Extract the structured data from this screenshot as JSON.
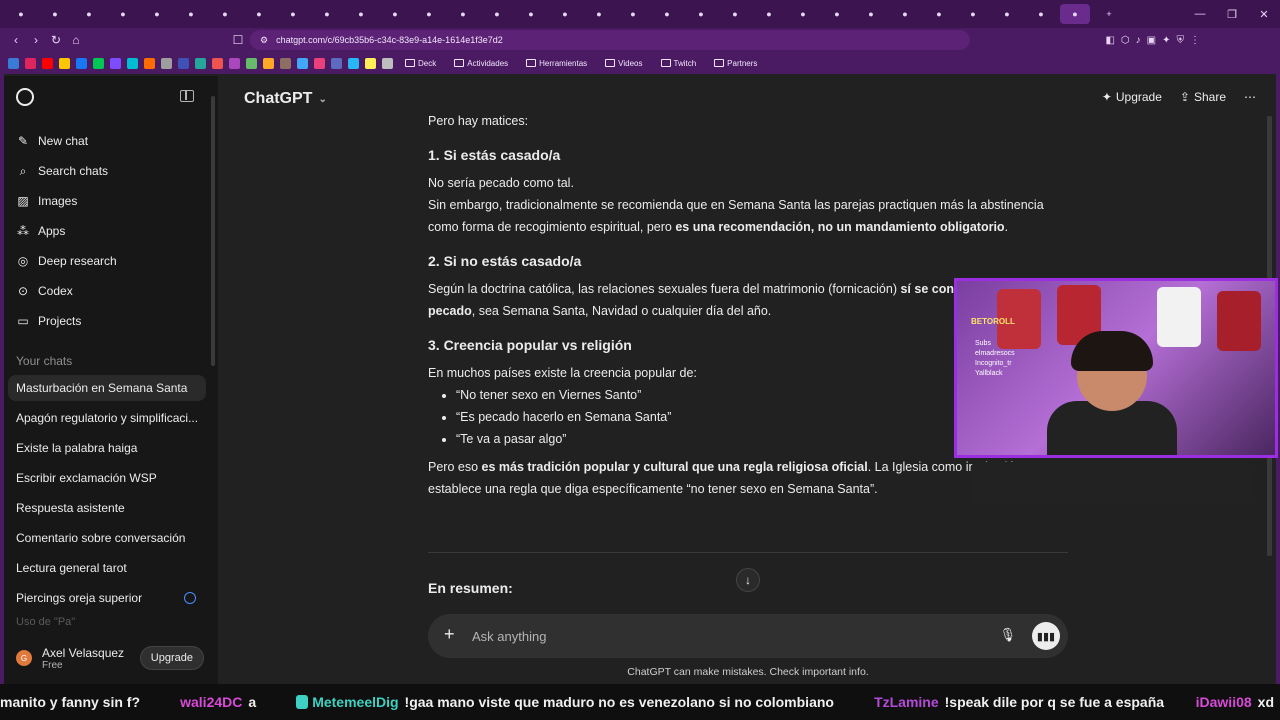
{
  "browser": {
    "tabs": [
      "",
      "",
      "",
      "",
      "",
      "",
      "",
      "",
      "",
      "",
      "",
      "",
      "",
      "",
      "",
      "",
      "",
      "",
      "",
      "",
      "",
      "",
      "",
      "",
      "",
      "",
      "",
      "",
      "",
      "",
      "",
      ""
    ],
    "url": "chatgpt.com/c/69cb35b6-c34c-83e9-a14e-1614e1f3e7d2",
    "bookmarks": [
      "Deck",
      "Actividades",
      "Herramientas",
      "Videos",
      "Twitch",
      "Partners"
    ]
  },
  "sidebar": {
    "items": [
      {
        "label": "New chat",
        "icon": "edit-icon"
      },
      {
        "label": "Search chats",
        "icon": "search-icon"
      },
      {
        "label": "Images",
        "icon": "image-icon"
      },
      {
        "label": "Apps",
        "icon": "apps-icon"
      },
      {
        "label": "Deep research",
        "icon": "research-icon"
      },
      {
        "label": "Codex",
        "icon": "codex-icon"
      },
      {
        "label": "Projects",
        "icon": "folder-icon"
      }
    ],
    "section_label": "Your chats",
    "chats": [
      "Masturbación en Semana Santa",
      "Apagón regulatorio y simplificaci...",
      "Existe la palabra haiga",
      "Escribir exclamación WSP",
      "Respuesta asistente",
      "Comentario sobre conversación",
      "Lectura general tarot",
      "Piercings oreja superior",
      "Uso de \"Pa\""
    ],
    "user": {
      "initial": "G",
      "name": "Axel Velasquez",
      "plan": "Free",
      "upgrade_label": "Upgrade"
    }
  },
  "header": {
    "model": "ChatGPT",
    "upgrade": "Upgrade",
    "share": "Share"
  },
  "message": {
    "intro": "Pero hay matices:",
    "s1_title": "1. Si estás casado/a",
    "s1_p1": "No sería pecado como tal.",
    "s1_p2a": "Sin embargo, tradicionalmente se recomienda que en Semana Santa las parejas practiquen más la abstinencia como forma de recogimiento espiritual, pero ",
    "s1_p2b": "es una recomendación, no un mandamiento obligatorio",
    "s1_p2c": ".",
    "s2_title": "2. Si no estás casado/a",
    "s2_p1a": "Según la doctrina católica, las relaciones sexuales fuera del matrimonio (fornicación) ",
    "s2_p1b": "sí se consideran pecado",
    "s2_p1c": ", sea Semana Santa, Navidad o cualquier día del año.",
    "s3_title": "3. Creencia popular vs religión",
    "s3_p1": "En muchos países existe la creencia popular de:",
    "bullets": [
      "“No tener sexo en Viernes Santo”",
      "“Es pecado hacerlo en Semana Santa”",
      "“Te va a pasar algo”"
    ],
    "s3_p2a": "Pero eso ",
    "s3_p2b": "es más tradición popular y cultural que una regla religiosa oficial",
    "s3_p2c": ". La Iglesia como institución no establece una regla que diga específicamente “no tener sexo en Semana Santa”.",
    "summary": "En resumen:"
  },
  "composer": {
    "placeholder": "Ask anything"
  },
  "disclaimer": "ChatGPT can make mistakes. Check important info.",
  "webcam": {
    "label": "BETOROLL",
    "lines": [
      "Subs",
      "elmadresocs",
      "Incognito_tr",
      "Yallblack"
    ]
  },
  "ticker": [
    {
      "text": "manito y fanny sin f?"
    },
    {
      "user": "wali24DC",
      "text": "a"
    },
    {
      "user": "MetemeelDig",
      "text": "!gaa mano viste que maduro no es venezolano si no colombiano"
    },
    {
      "user": "TzLamine",
      "text": "!speak dile por q se fue a españa"
    },
    {
      "user": "iDawii08",
      "text": "xd"
    }
  ],
  "colors": {
    "sidebar": "#171717",
    "main": "#212121",
    "browser_frame": "#4a1a63",
    "webcam_border": "#9b2ee0"
  }
}
